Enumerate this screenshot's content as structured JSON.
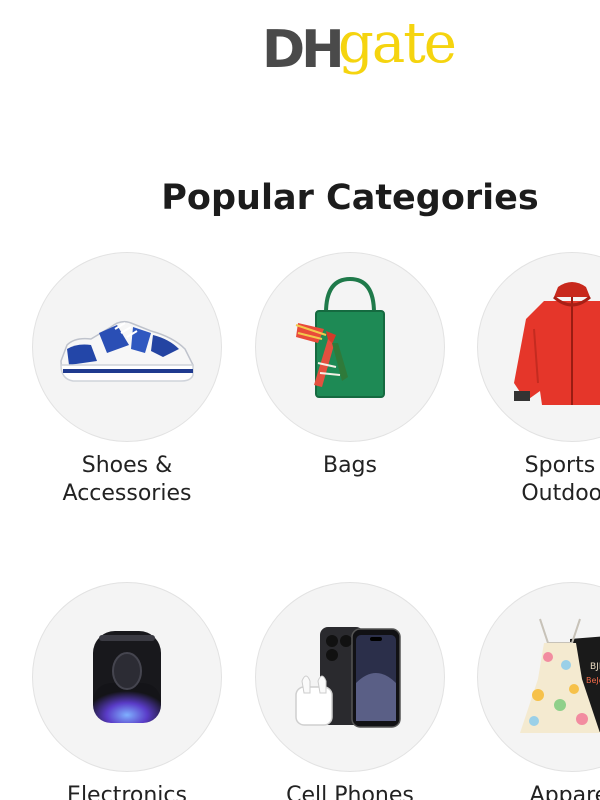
{
  "header": {
    "logo_dh": "DH",
    "logo_gate": "gate",
    "logo_colors": {
      "dh": "#4a4a4a",
      "gate": "#f5d40f"
    }
  },
  "section": {
    "title": "Popular Categories"
  },
  "categories": [
    {
      "label": "Shoes &\nAccessories",
      "icon": "sneaker-image"
    },
    {
      "label": "Bags",
      "icon": "handbag-image"
    },
    {
      "label": "Sports &\nOutdoors",
      "icon": "jacket-image"
    },
    {
      "label": "Electronics",
      "icon": "smart-speaker-image"
    },
    {
      "label": "Cell Phones",
      "icon": "phone-earbuds-image"
    },
    {
      "label": "Apparel",
      "icon": "dress-sweatshirt-image"
    }
  ]
}
